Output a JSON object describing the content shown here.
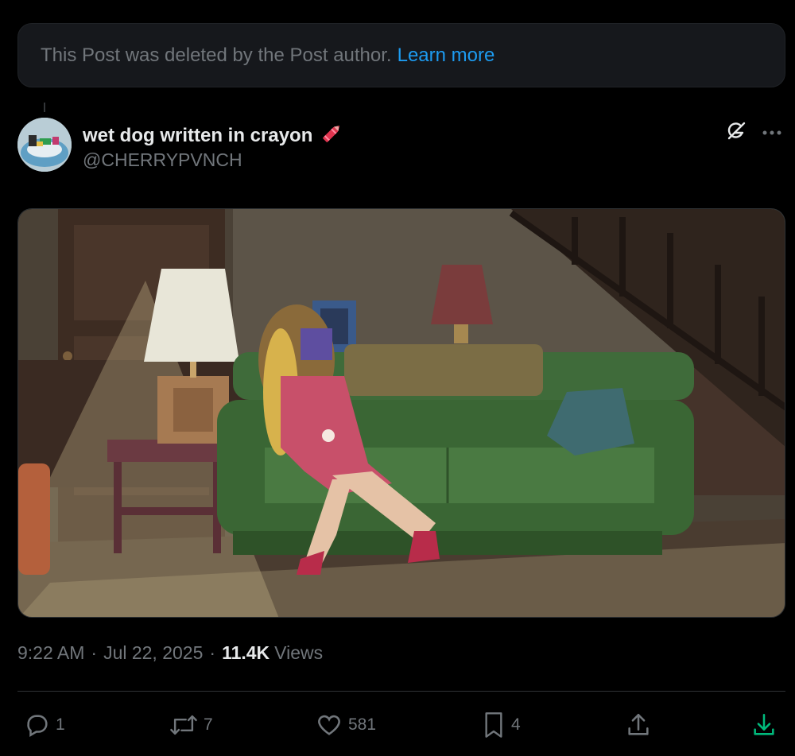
{
  "notice": {
    "text": "This Post was deleted by the Post author.",
    "link": "Learn more"
  },
  "author": {
    "display_name": "wet dog written in crayon",
    "handle": "@CHERRYPVNCH",
    "name_emoji": "crayon-icon"
  },
  "icons": {
    "grok": "grok-icon",
    "more": "more-icon"
  },
  "meta": {
    "time": "9:22 AM",
    "date": "Jul 22, 2025",
    "views_count": "11.4K",
    "views_label": "Views",
    "separator": "·"
  },
  "actions": {
    "replies": "1",
    "reposts": "7",
    "likes": "581",
    "bookmarks": "4"
  },
  "colors": {
    "background": "#000000",
    "link": "#1d9bf0",
    "muted": "#71767b",
    "download": "#00ba7c"
  }
}
